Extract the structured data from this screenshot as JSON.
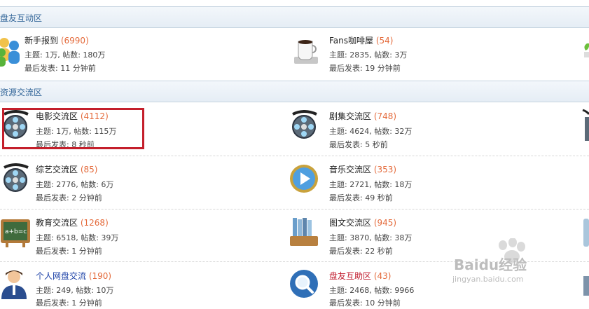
{
  "sections": [
    {
      "title": "盘友互动区"
    },
    {
      "title": "资源交流区"
    }
  ],
  "forums": {
    "newbie": {
      "name": "新手报到",
      "count": "(6990)",
      "stats": "主题: 1万, 帖数: 180万",
      "last": "最后发表: 11 分钟前"
    },
    "fans": {
      "name": "Fans咖啡屋",
      "count": "(54)",
      "stats": "主题: 2835, 帖数: 3万",
      "last": "最后发表: 19 分钟前"
    },
    "movie": {
      "name": "电影交流区",
      "count": "(4112)",
      "stats": "主题: 1万, 帖数: 115万",
      "last": "最后发表: 8 秒前"
    },
    "tv": {
      "name": "剧集交流区",
      "count": "(748)",
      "stats": "主题: 4624, 帖数: 32万",
      "last": "最后发表: 5 秒前"
    },
    "variety": {
      "name": "综艺交流区",
      "count": "(85)",
      "stats": "主题: 2776, 帖数: 6万",
      "last": "最后发表: 2 分钟前"
    },
    "music": {
      "name": "音乐交流区",
      "count": "(353)",
      "stats": "主题: 2721, 帖数: 18万",
      "last": "最后发表: 49 秒前"
    },
    "edu": {
      "name": "教育交流区",
      "count": "(1268)",
      "stats": "主题: 6518, 帖数: 39万",
      "last": "最后发表: 1 分钟前"
    },
    "books": {
      "name": "图文交流区",
      "count": "(945)",
      "stats": "主题: 3870, 帖数: 38万",
      "last": "最后发表: 22 秒前"
    },
    "personal": {
      "name": "个人网盘交流",
      "count": "(190)",
      "stats": "主题: 249, 帖数: 10万",
      "last": "最后发表: 1 分钟前"
    },
    "help": {
      "name": "盘友互助区",
      "count": "(43)",
      "stats": "主题: 2468, 帖数: 9966",
      "last": "最后发表: 10 分钟前"
    }
  },
  "watermark": {
    "brand": "Baidu经验",
    "url": "jingyan.baidu.com"
  },
  "colors": {
    "accent": "#336699",
    "count": "#e46b3c",
    "highlight": "#c41f2b"
  }
}
